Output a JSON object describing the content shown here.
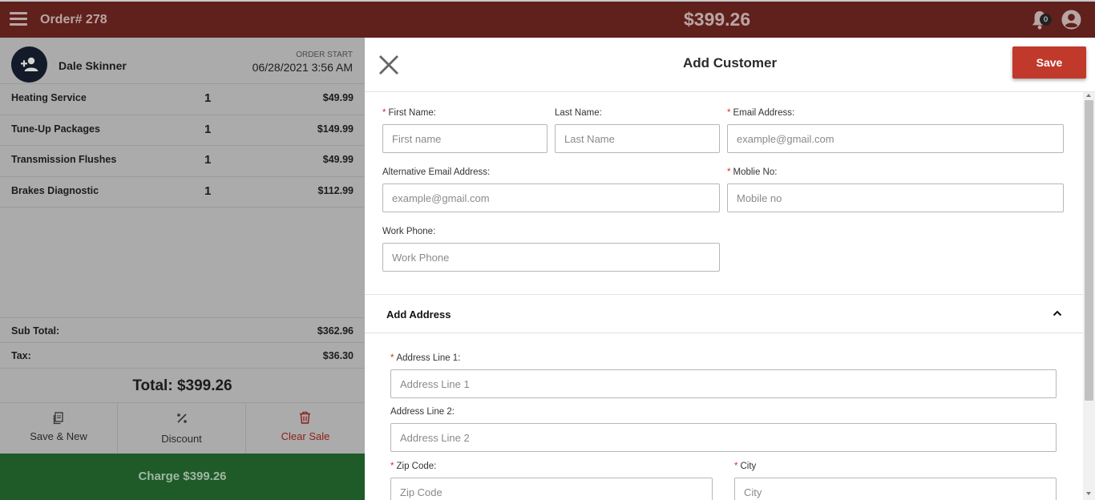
{
  "header": {
    "order_label": "Order# 278",
    "total": "$399.26",
    "notification_count": "0",
    "brand_color": "#60201c"
  },
  "customer": {
    "name": "Dale Skinner",
    "order_start_label": "ORDER START",
    "order_start_date": "06/28/2021 3:56 AM"
  },
  "items": [
    {
      "name": "Heating Service",
      "qty": "1",
      "price": "$49.99"
    },
    {
      "name": "Tune-Up Packages",
      "qty": "1",
      "price": "$149.99"
    },
    {
      "name": "Transmission Flushes",
      "qty": "1",
      "price": "$49.99"
    },
    {
      "name": "Brakes Diagnostic",
      "qty": "1",
      "price": "$112.99"
    }
  ],
  "summary": {
    "subtotal_label": "Sub Total:",
    "subtotal_value": "$362.96",
    "tax_label": "Tax:",
    "tax_value": "$36.30",
    "total_text": "Total: $399.26"
  },
  "actions": {
    "save_new": "Save & New",
    "discount": "Discount",
    "clear_sale": "Clear Sale",
    "charge": "Charge $399.26"
  },
  "modal": {
    "title": "Add Customer",
    "save_label": "Save",
    "required_mark": "*",
    "fields": {
      "first_name": {
        "label": "First Name:",
        "placeholder": "First name"
      },
      "last_name": {
        "label": "Last Name:",
        "placeholder": "Last Name"
      },
      "email": {
        "label": "Email Address:",
        "placeholder": "example@gmail.com"
      },
      "alt_email": {
        "label": "Alternative Email Address:",
        "placeholder": "example@gmail.com"
      },
      "mobile": {
        "label": "Moblie No:",
        "placeholder": "Mobile no"
      },
      "work_phone": {
        "label": "Work Phone:",
        "placeholder": "Work Phone"
      }
    },
    "address": {
      "section_title": "Add Address",
      "line1": {
        "label": "Address Line 1:",
        "placeholder": "Address Line 1"
      },
      "line2": {
        "label": "Address Line 2:",
        "placeholder": "Address Line 2"
      },
      "zip": {
        "label": "Zip Code:",
        "placeholder": "Zip Code"
      },
      "city": {
        "label": "City",
        "placeholder": "City"
      }
    }
  }
}
